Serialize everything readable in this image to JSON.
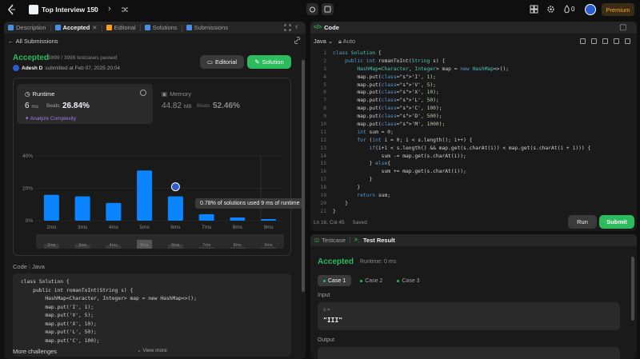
{
  "topnav": {
    "list_title": "Top Interview 150",
    "streak": "0",
    "premium": "Premium"
  },
  "left": {
    "tabs": [
      {
        "label": "Description",
        "active": false
      },
      {
        "label": "Accepted",
        "active": true,
        "closable": true
      },
      {
        "label": "Editorial",
        "active": false
      },
      {
        "label": "Solutions",
        "active": false
      },
      {
        "label": "Submissions",
        "active": false
      }
    ],
    "back_label": "All Submissions",
    "status": "Accepted",
    "passed": "3999 / 3999 testcases passed",
    "author": "Adesh D",
    "submitted": "submitted at Feb 07, 2025 20:04",
    "editorial_btn": "Editorial",
    "solution_btn": "Solution",
    "runtime": {
      "label": "Runtime",
      "value": "6",
      "unit": "ms",
      "beats_label": "Beats",
      "beats": "26.84%",
      "analyze": "Analyze Complexity"
    },
    "memory": {
      "label": "Memory",
      "value": "44.82",
      "unit": "MB",
      "beats_label": "Beats",
      "beats": "52.46%"
    },
    "tooltip": "0.78% of solutions used 9 ms of runtime",
    "code_header": "Code",
    "code_lang": "Java",
    "code_preview": "class Solution {\n    public int romanToInt(String s) {\n        HashMap<Character, Integer> map = new HashMap<>();\n        map.put('I', 1);\n        map.put('V', 5);\n        map.put('X', 10);\n        map.put('L', 50);\n        map.put('C', 100);",
    "view_more": "View more",
    "more_challenges": "More challenges"
  },
  "chart_data": {
    "type": "bar",
    "categories": [
      "2ms",
      "3ms",
      "4ms",
      "5ms",
      "6ms",
      "7ms",
      "8ms",
      "9ms"
    ],
    "values": [
      16,
      15,
      11,
      31,
      15,
      4,
      2,
      1
    ],
    "highlight_index": 4,
    "ylim": [
      0,
      40
    ],
    "yticks": [
      "0%",
      "20%",
      "40%"
    ],
    "grid": true,
    "bar_color": "#0a84ff"
  },
  "right": {
    "code_title": "Code",
    "lang": "Java",
    "auto": "Auto",
    "status": "Ln 16, Col 45",
    "saved": "Saved",
    "run": "Run",
    "submit": "Submit",
    "code_lines": [
      "class Solution {",
      "    public int romanToInt(String s) {",
      "        HashMap<Character, Integer> map = new HashMap<>();",
      "        map.put('I', 1);",
      "        map.put('V', 5);",
      "        map.put('X', 10);",
      "        map.put('L', 50);",
      "        map.put('C', 100);",
      "        map.put('D', 500);",
      "        map.put('M', 1000);",
      "        int sum = 0;",
      "        for (int i = 0; i < s.length(); i++) {",
      "            if(i+1 < s.length() && map.get(s.charAt(i)) < map.get(s.charAt(i + 1))) {",
      "                sum -= map.get(s.charAt(i));",
      "            } else{",
      "                sum += map.get(s.charAt(i));",
      "            }",
      "        }",
      "        return sum;",
      "    }",
      "}"
    ]
  },
  "test": {
    "tab_testcase": "Testcase",
    "tab_result": "Test Result",
    "status": "Accepted",
    "runtime": "Runtime: 0 ms",
    "cases": [
      "Case 1",
      "Case 2",
      "Case 3"
    ],
    "input_label": "Input",
    "input_var": "s =",
    "input_val": "\"III\"",
    "output_label": "Output"
  },
  "colors": {
    "accent_green": "#2cbb5d",
    "bar_blue": "#0a84ff",
    "premium_orange": "#ffa116"
  }
}
